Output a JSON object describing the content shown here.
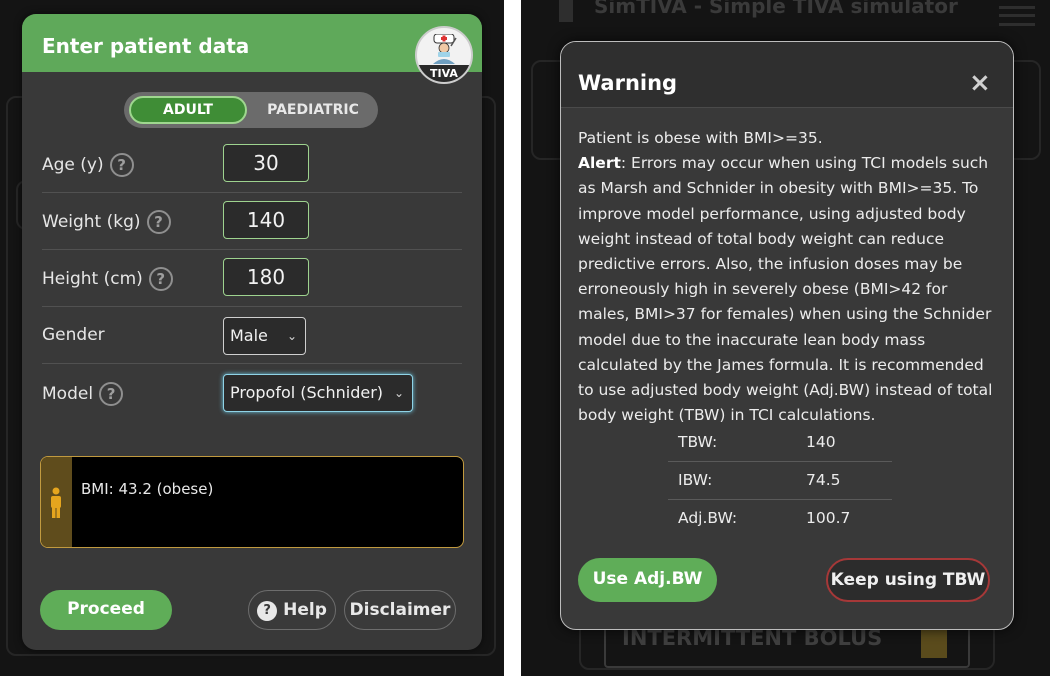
{
  "left": {
    "title": "Enter patient data",
    "logo_text": "TIVA",
    "mode": {
      "adult": "ADULT",
      "paediatric": "PAEDIATRIC",
      "selected": "ADULT"
    },
    "fields": {
      "age": {
        "label": "Age (y)",
        "value": "30"
      },
      "weight": {
        "label": "Weight (kg)",
        "value": "140"
      },
      "height": {
        "label": "Height (cm)",
        "value": "180"
      },
      "gender": {
        "label": "Gender",
        "value": "Male"
      },
      "model": {
        "label": "Model",
        "value": "Propofol (Schnider)"
      }
    },
    "bmi_text": "BMI: 43.2 (obese)",
    "buttons": {
      "proceed": "Proceed",
      "help": "Help",
      "disclaimer": "Disclaimer"
    },
    "colors": {
      "accent": "#5fad58",
      "bmi_border": "#c19a3f"
    }
  },
  "right": {
    "background": {
      "app_title": "SimTIVA - Simple TIVA simulator",
      "bolus_label": "INTERMITTENT BOLUS"
    },
    "warning": {
      "title": "Warning",
      "close": "×",
      "line1": "Patient is obese with BMI>=35.",
      "alert_label": "Alert",
      "alert_text": ": Errors may occur when using TCI models such as Marsh and Schnider in obesity with BMI>=35. To improve model performance, using adjusted body weight instead of total body weight can reduce predictive errors. Also, the infusion doses may be erroneously high in severely obese (BMI>42 for males, BMI>37 for females) when using the Schnider model due to the inaccurate lean body mass calculated by the James formula. It is recommended to use adjusted body weight (Adj.BW) instead of total body weight (TBW) in TCI calculations.",
      "table": [
        {
          "key": "TBW:",
          "value": "140"
        },
        {
          "key": "IBW:",
          "value": "74.5"
        },
        {
          "key": "Adj.BW:",
          "value": "100.7"
        }
      ],
      "buttons": {
        "use_adj": "Use Adj.BW",
        "keep_tbw": "Keep using TBW"
      }
    },
    "colors": {
      "accent": "#5fad58",
      "danger": "#a63838"
    }
  }
}
